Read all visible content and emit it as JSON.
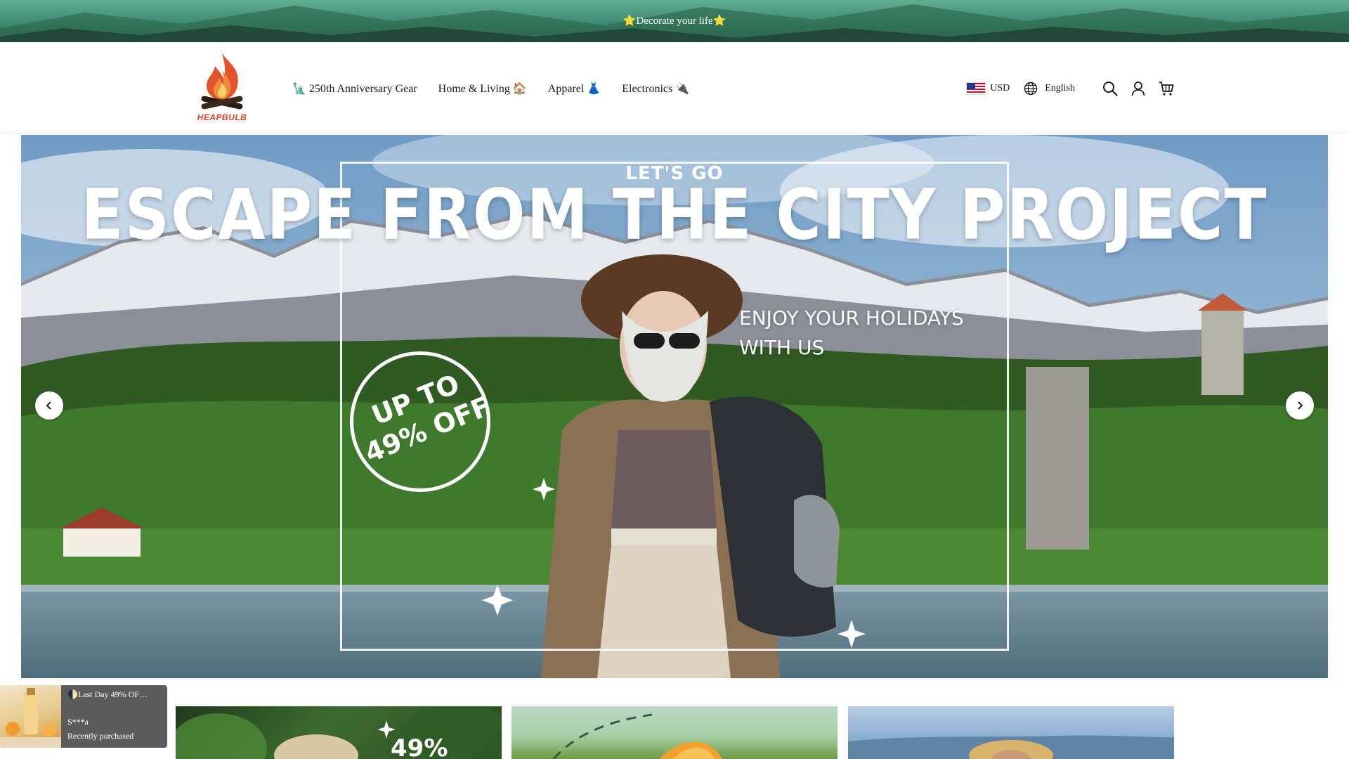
{
  "announcement": {
    "text": "⭐Decorate your life⭐"
  },
  "header": {
    "logo_text": "HEAPBULB",
    "nav": [
      {
        "label": "🗽 250th Anniversary Gear"
      },
      {
        "label": "Home & Living 🏠"
      },
      {
        "label": "Apparel 👗"
      },
      {
        "label": "Electronics 🔌"
      }
    ],
    "currency": "USD",
    "language": "English",
    "icons": [
      "globe-icon",
      "search-icon",
      "account-icon",
      "cart-icon"
    ]
  },
  "hero": {
    "kicker": "LET'S GO",
    "title": "ESCAPE FROM THE CITY PROJECT",
    "subtitle_line1": "ENJOY YOUR HOLIDAYS",
    "subtitle_line2": "WITH US",
    "badge_line1": "UP TO",
    "badge_line2": "49% OFF",
    "prev_icon": "chevron-left-icon",
    "next_icon": "chevron-right-icon"
  },
  "cards": [
    {
      "text": "49%"
    },
    {
      "text": ""
    },
    {
      "text": ""
    }
  ],
  "popup": {
    "title": "🌓Last Day 49% OF…",
    "name": "S***a",
    "status": "Recently purchased"
  }
}
